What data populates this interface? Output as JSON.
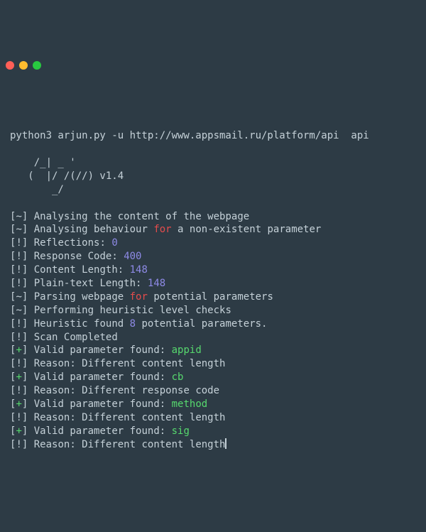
{
  "titlebar": {},
  "cmd_line": "python3 arjun.py -u http://www.appsmail.ru/platform/api  api",
  "ascii": {
    "l1": "    /_| _ '  ",
    "l2": "   (  |/ /(//) v1.4",
    "l3": "       _/"
  },
  "lines": [
    {
      "tag": "~",
      "segs": [
        {
          "t": "Analysing the content of the webpage"
        }
      ]
    },
    {
      "tag": "~",
      "segs": [
        {
          "t": "Analysing behaviour "
        },
        {
          "t": "for",
          "cls": "kw"
        },
        {
          "t": " a non-existent parameter"
        }
      ]
    },
    {
      "tag": "!",
      "segs": [
        {
          "t": "Reflections: "
        },
        {
          "t": "0",
          "cls": "num"
        }
      ]
    },
    {
      "tag": "!",
      "segs": [
        {
          "t": "Response Code: "
        },
        {
          "t": "400",
          "cls": "num"
        }
      ]
    },
    {
      "tag": "!",
      "segs": [
        {
          "t": "Content Length: "
        },
        {
          "t": "148",
          "cls": "num"
        }
      ]
    },
    {
      "tag": "!",
      "segs": [
        {
          "t": "Plain-text Length: "
        },
        {
          "t": "148",
          "cls": "num"
        }
      ]
    },
    {
      "tag": "~",
      "segs": [
        {
          "t": "Parsing webpage "
        },
        {
          "t": "for",
          "cls": "kw"
        },
        {
          "t": " potential parameters"
        }
      ]
    },
    {
      "tag": "~",
      "segs": [
        {
          "t": "Performing heuristic level checks"
        }
      ]
    },
    {
      "tag": "!",
      "segs": [
        {
          "t": "Heuristic found "
        },
        {
          "t": "8",
          "cls": "num"
        },
        {
          "t": " potential parameters."
        }
      ]
    },
    {
      "tag": "!",
      "segs": [
        {
          "t": "Scan Completed"
        }
      ]
    },
    {
      "tag": "+",
      "segs": [
        {
          "t": "Valid parameter found: "
        },
        {
          "t": "appid",
          "cls": "val"
        }
      ]
    },
    {
      "tag": "!",
      "segs": [
        {
          "t": "Reason: Different content length"
        }
      ]
    },
    {
      "tag": "+",
      "segs": [
        {
          "t": "Valid parameter found: "
        },
        {
          "t": "cb",
          "cls": "val"
        }
      ]
    },
    {
      "tag": "!",
      "segs": [
        {
          "t": "Reason: Different response code"
        }
      ]
    },
    {
      "tag": "+",
      "segs": [
        {
          "t": "Valid parameter found: "
        },
        {
          "t": "method",
          "cls": "val"
        }
      ]
    },
    {
      "tag": "!",
      "segs": [
        {
          "t": "Reason: Different content length"
        }
      ]
    },
    {
      "tag": "+",
      "segs": [
        {
          "t": "Valid parameter found: "
        },
        {
          "t": "sig",
          "cls": "val"
        }
      ]
    },
    {
      "tag": "!",
      "segs": [
        {
          "t": "Reason: Different content length"
        }
      ],
      "cursor": true
    }
  ]
}
